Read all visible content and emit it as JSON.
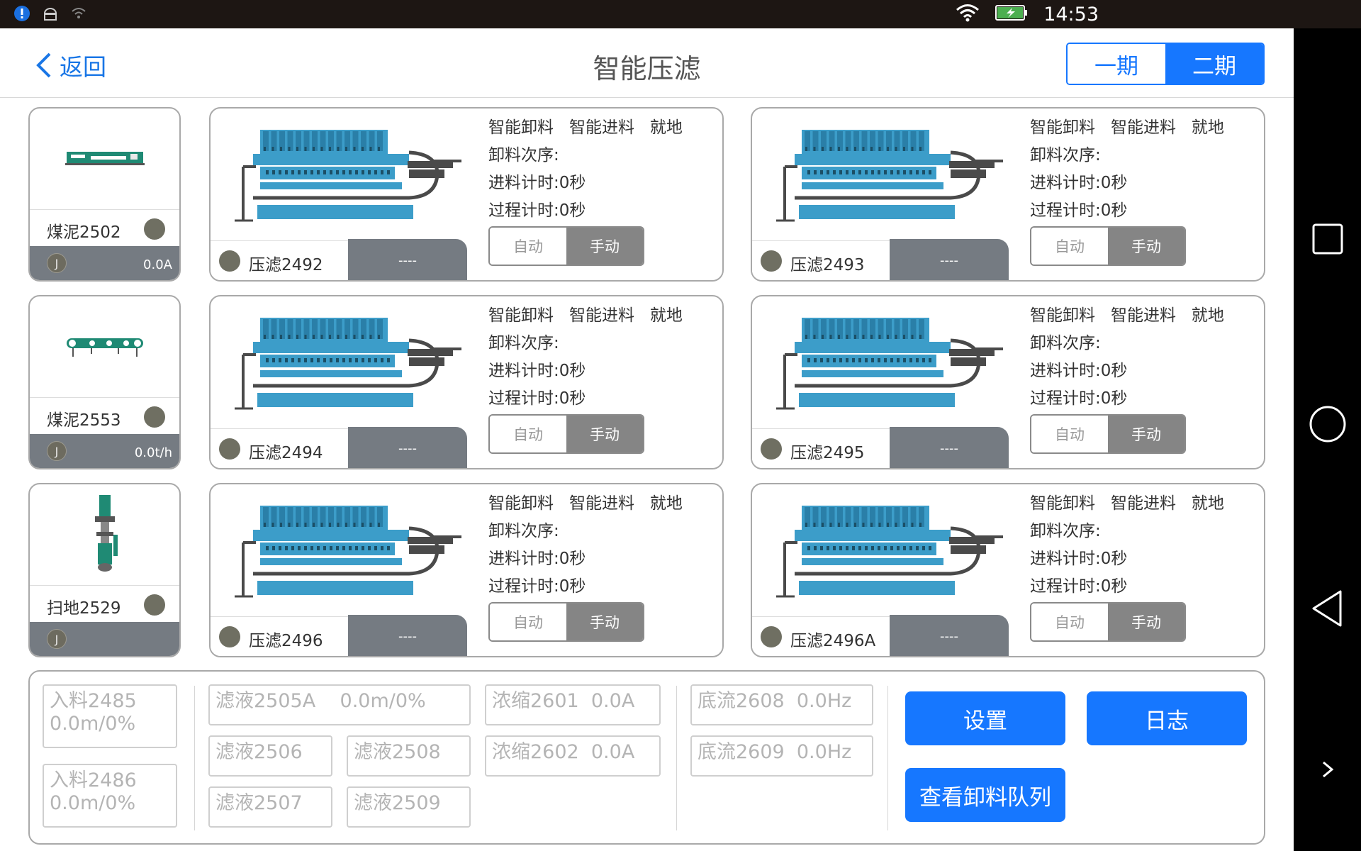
{
  "statusbar": {
    "time": "14:53"
  },
  "header": {
    "back_label": "返回",
    "title": "智能压滤",
    "periods": [
      "一期",
      "二期"
    ]
  },
  "equipment": [
    {
      "name": "煤泥2502",
      "j": "J",
      "value": "0.0A",
      "icon": "conveyor-icon"
    },
    {
      "name": "煤泥2553",
      "j": "J",
      "value": "0.0t/h",
      "icon": "belt-conveyor-icon"
    },
    {
      "name": "扫地2529",
      "j": "J",
      "value": "",
      "icon": "pump-icon"
    }
  ],
  "filter_card_labels": {
    "smart_unload": "智能卸料",
    "smart_feed": "智能进料",
    "local": "就地",
    "unload_order": "卸料次序:",
    "feed_timer": "进料计时:",
    "process_timer": "过程计时:",
    "auto": "自动",
    "manual": "手动"
  },
  "filter_presses": [
    {
      "name": "压滤2492",
      "status": "----",
      "feed_time": "0秒",
      "process_time": "0秒"
    },
    {
      "name": "压滤2493",
      "status": "----",
      "feed_time": "0秒",
      "process_time": "0秒"
    },
    {
      "name": "压滤2494",
      "status": "----",
      "feed_time": "0秒",
      "process_time": "0秒"
    },
    {
      "name": "压滤2495",
      "status": "----",
      "feed_time": "0秒",
      "process_time": "0秒"
    },
    {
      "name": "压滤2496",
      "status": "----",
      "feed_time": "0秒",
      "process_time": "0秒"
    },
    {
      "name": "压滤2496A",
      "status": "----",
      "feed_time": "0秒",
      "process_time": "0秒"
    }
  ],
  "bottom": {
    "feed_2485": "入料2485\n0.0m/0%",
    "feed_2486": "入料2486\n0.0m/0%",
    "filtrate_2505a": "滤液2505A    0.0m/0%",
    "filtrate_2506": "滤液2506",
    "filtrate_2508": "滤液2508",
    "filtrate_2507": "滤液2507",
    "filtrate_2509": "滤液2509",
    "thicken_2601": "浓缩2601  0.0A",
    "thicken_2602": "浓缩2602  0.0A",
    "underflow_2608": "底流2608  0.0Hz",
    "underflow_2609": "底流2609  0.0Hz",
    "settings": "设置",
    "log": "日志",
    "view_queue": "查看卸料队列"
  },
  "colors": {
    "accent": "#1677ff",
    "status_gray": "#757b82",
    "press_blue": "#3c9dc9"
  }
}
